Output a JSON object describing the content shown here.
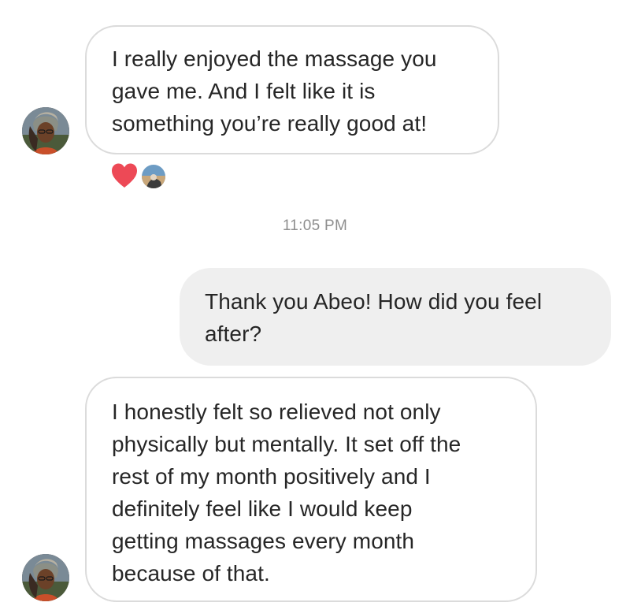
{
  "conversation": {
    "messages": [
      {
        "direction": "incoming",
        "text": "I really enjoyed the massage you\ngave me. And I felt like it is\nsomething you’re really good at!"
      },
      {
        "direction": "outgoing",
        "text": "Thank you Abeo! How did you feel\nafter?"
      },
      {
        "direction": "incoming",
        "text": "I honestly felt so relieved not only\nphysically but mentally. It set off the\nrest of my month positively and I\ndefinitely feel like I would keep\ngetting massages every month\nbecause of that."
      }
    ],
    "reactions": {
      "emoji_icon": "heart-icon",
      "heart_color": "#ed4956"
    },
    "timestamp": "11:05 PM"
  },
  "colors": {
    "incoming_border": "#dbdbdb",
    "outgoing_background": "#efefef",
    "timestamp_text": "#8e8e8e",
    "message_text": "#262626"
  }
}
